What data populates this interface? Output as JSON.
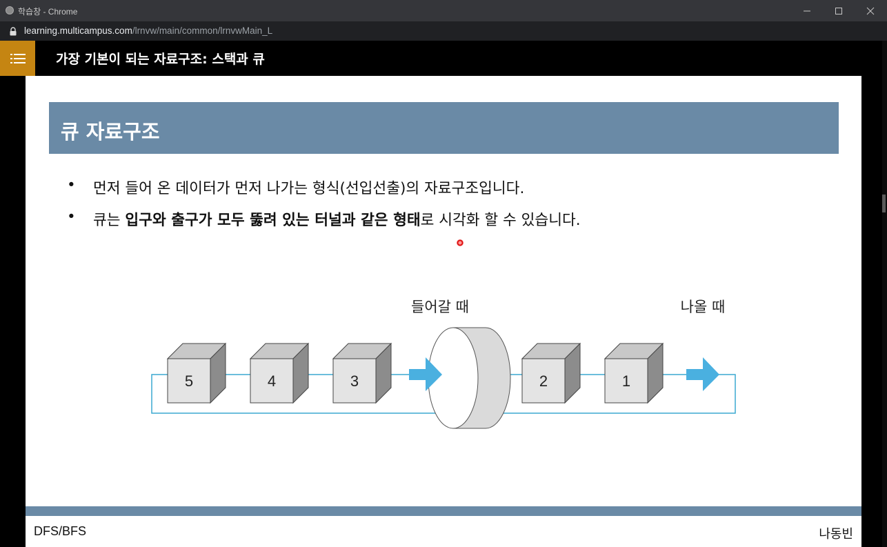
{
  "window": {
    "title": "학습창 - Chrome",
    "controls": {
      "minimize": "minimize-icon",
      "maximize": "maximize-icon",
      "close": "close-icon"
    }
  },
  "address_bar": {
    "url_host": "learning.multicampus.com",
    "url_path": "/lrnvw/main/common/lrnvwMain_L"
  },
  "header": {
    "menu_icon": "list-menu-icon",
    "lesson_title": "가장 기본이 되는 자료구조: 스택과 큐",
    "accent_color": "#c58512"
  },
  "slide": {
    "heading": "큐 자료구조",
    "heading_color": "#6a8aa6",
    "bullets": [
      {
        "marker": "•",
        "text": "먼저 들어 온 데이터가 먼저 나가는 형식(선입선출)의 자료구조입니다."
      },
      {
        "marker": "•",
        "prefix": "큐는 ",
        "bold": "입구와 출구가 모두 뚫려 있는 터널과 같은 형태",
        "suffix": "로 시각화 할 수 있습니다."
      }
    ],
    "diagram": {
      "label_enter": "들어갈 때",
      "label_exit": "나올 때",
      "boxes_waiting": [
        "5",
        "4",
        "3"
      ],
      "boxes_passed": [
        "2",
        "1"
      ],
      "arrow_color": "#4ab0e0",
      "line_color": "#3aa8d0"
    },
    "footer_left": "DFS/BFS",
    "footer_right": "나동빈"
  }
}
